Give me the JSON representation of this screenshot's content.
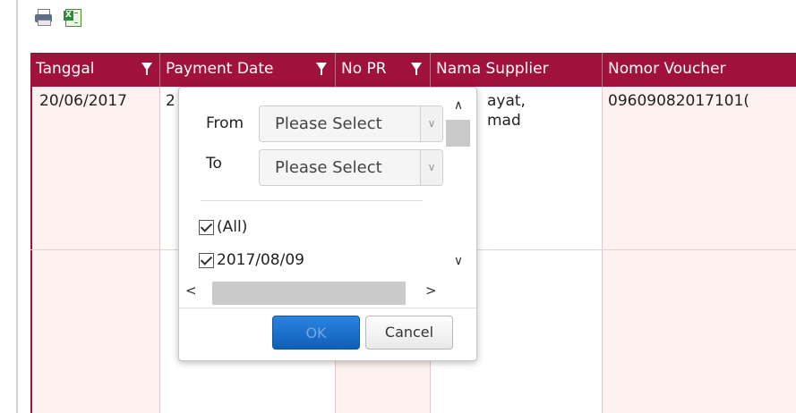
{
  "toolbar": {
    "print_icon": "print-icon",
    "excel_icon": "excel-export-icon",
    "excel_glyph": "X"
  },
  "grid": {
    "header_bg": "#a0123c",
    "columns": [
      {
        "label": "Tanggal",
        "has_filter": true
      },
      {
        "label": "Payment Date",
        "has_filter": true
      },
      {
        "label": "No PR",
        "has_filter": true
      },
      {
        "label": "Nama Supplier",
        "has_filter": false
      },
      {
        "label": "Nomor Voucher",
        "has_filter": false
      }
    ],
    "rows": [
      {
        "tanggal": "20/06/2017",
        "payment_date_partial": "2",
        "nama_supplier_line1": "ayat,",
        "nama_supplier_line2": "mad",
        "nomor_voucher": "09609082017101("
      }
    ]
  },
  "filter_popup": {
    "from_label": "From",
    "to_label": "To",
    "from_value": "Please Select",
    "to_value": "Please Select",
    "options": [
      {
        "label": "(All)",
        "checked": true
      },
      {
        "label": "2017/08/09",
        "checked": true
      }
    ],
    "ok_label": "OK",
    "cancel_label": "Cancel"
  }
}
